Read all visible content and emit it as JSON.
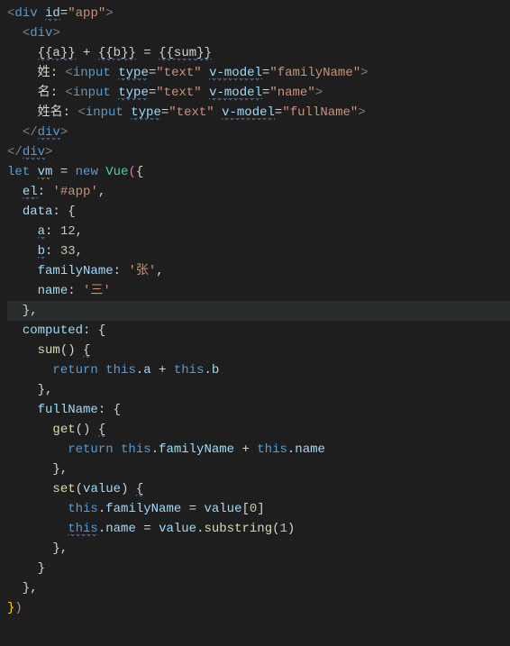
{
  "lines": [
    [
      {
        "t": "<",
        "c": "c-angle"
      },
      {
        "t": "div ",
        "c": "c-tag"
      },
      {
        "t": "id",
        "c": "c-attr",
        "sq": "info"
      },
      {
        "t": "=",
        "c": "c-text"
      },
      {
        "t": "\"app\"",
        "c": "c-str"
      },
      {
        "t": ">",
        "c": "c-angle"
      }
    ],
    [
      {
        "t": "  ",
        "c": ""
      },
      {
        "t": "<",
        "c": "c-angle"
      },
      {
        "t": "div",
        "c": "c-tag"
      },
      {
        "t": ">",
        "c": "c-angle"
      }
    ],
    [
      {
        "t": "    ",
        "c": ""
      },
      {
        "t": "{{",
        "c": "c-text",
        "sq": "info"
      },
      {
        "t": "a",
        "c": "c-text",
        "sq": "info"
      },
      {
        "t": "}}",
        "c": "c-text",
        "sq": "info"
      },
      {
        "t": " + ",
        "c": "c-text"
      },
      {
        "t": "{{",
        "c": "c-text",
        "sq": "info"
      },
      {
        "t": "b",
        "c": "c-text",
        "sq": "info"
      },
      {
        "t": "}}",
        "c": "c-text",
        "sq": "info"
      },
      {
        "t": " = ",
        "c": "c-text"
      },
      {
        "t": "{{",
        "c": "c-text",
        "sq": "info"
      },
      {
        "t": "sum",
        "c": "c-text",
        "sq": "info"
      },
      {
        "t": "}}",
        "c": "c-text",
        "sq": "info"
      }
    ],
    [
      {
        "t": "    姓: ",
        "c": "c-text"
      },
      {
        "t": "<",
        "c": "c-angle"
      },
      {
        "t": "input ",
        "c": "c-tag"
      },
      {
        "t": "type",
        "c": "c-attr",
        "sq": "info"
      },
      {
        "t": "=",
        "c": "c-text"
      },
      {
        "t": "\"text\"",
        "c": "c-str"
      },
      {
        "t": " ",
        "c": ""
      },
      {
        "t": "v-model",
        "c": "c-attr",
        "sq": "info"
      },
      {
        "t": "=",
        "c": "c-text"
      },
      {
        "t": "\"familyName\"",
        "c": "c-str"
      },
      {
        "t": ">",
        "c": "c-angle"
      }
    ],
    [
      {
        "t": "    名: ",
        "c": "c-text"
      },
      {
        "t": "<",
        "c": "c-angle"
      },
      {
        "t": "input ",
        "c": "c-tag"
      },
      {
        "t": "type",
        "c": "c-attr",
        "sq": "info"
      },
      {
        "t": "=",
        "c": "c-text"
      },
      {
        "t": "\"text\"",
        "c": "c-str"
      },
      {
        "t": " ",
        "c": ""
      },
      {
        "t": "v-model",
        "c": "c-attr",
        "sq": "info"
      },
      {
        "t": "=",
        "c": "c-text"
      },
      {
        "t": "\"name\"",
        "c": "c-str"
      },
      {
        "t": ">",
        "c": "c-angle"
      }
    ],
    [
      {
        "t": "    姓名: ",
        "c": "c-text"
      },
      {
        "t": "<",
        "c": "c-angle"
      },
      {
        "t": "input ",
        "c": "c-tag"
      },
      {
        "t": "type",
        "c": "c-attr",
        "sq": "info"
      },
      {
        "t": "=",
        "c": "c-text"
      },
      {
        "t": "\"text\"",
        "c": "c-str"
      },
      {
        "t": " ",
        "c": ""
      },
      {
        "t": "v-model",
        "c": "c-attr",
        "sq": "info"
      },
      {
        "t": "=",
        "c": "c-text"
      },
      {
        "t": "\"fullName\"",
        "c": "c-str"
      },
      {
        "t": ">",
        "c": "c-angle"
      }
    ],
    [
      {
        "t": "  ",
        "c": ""
      },
      {
        "t": "</",
        "c": "c-angle"
      },
      {
        "t": "div",
        "c": "c-tag",
        "sq": "info"
      },
      {
        "t": ">",
        "c": "c-angle"
      }
    ],
    [
      {
        "t": "</",
        "c": "c-angle"
      },
      {
        "t": "div",
        "c": "c-tag",
        "sq": "info"
      },
      {
        "t": ">",
        "c": "c-angle"
      }
    ],
    [
      {
        "t": "let ",
        "c": "c-key"
      },
      {
        "t": "vm",
        "c": "c-attr",
        "sq": "warn"
      },
      {
        "t": " = ",
        "c": "c-text"
      },
      {
        "t": "new ",
        "c": "c-key"
      },
      {
        "t": "Vue",
        "c": "c-type"
      },
      {
        "t": "(",
        "c": "c-brace"
      },
      {
        "t": "{",
        "c": "c-text"
      }
    ],
    [
      {
        "t": "  ",
        "c": ""
      },
      {
        "t": "el",
        "c": "c-attr",
        "sq": "info"
      },
      {
        "t": ": ",
        "c": "c-text"
      },
      {
        "t": "'#app'",
        "c": "c-str"
      },
      {
        "t": ",",
        "c": "c-text"
      }
    ],
    [
      {
        "t": "  ",
        "c": ""
      },
      {
        "t": "data",
        "c": "c-attr"
      },
      {
        "t": ": {",
        "c": "c-text"
      }
    ],
    [
      {
        "t": "    ",
        "c": ""
      },
      {
        "t": "a",
        "c": "c-attr",
        "sq": "info"
      },
      {
        "t": ": ",
        "c": "c-text"
      },
      {
        "t": "12",
        "c": "c-num"
      },
      {
        "t": ",",
        "c": "c-text"
      }
    ],
    [
      {
        "t": "    ",
        "c": ""
      },
      {
        "t": "b",
        "c": "c-attr",
        "sq": "info"
      },
      {
        "t": ": ",
        "c": "c-text"
      },
      {
        "t": "33",
        "c": "c-num"
      },
      {
        "t": ",",
        "c": "c-text"
      }
    ],
    [
      {
        "t": "    ",
        "c": ""
      },
      {
        "t": "familyName",
        "c": "c-attr"
      },
      {
        "t": ": ",
        "c": "c-text"
      },
      {
        "t": "'张'",
        "c": "c-str"
      },
      {
        "t": ",",
        "c": "c-text"
      }
    ],
    [
      {
        "t": "    ",
        "c": ""
      },
      {
        "t": "name",
        "c": "c-attr"
      },
      {
        "t": ": ",
        "c": "c-text"
      },
      {
        "t": "'三'",
        "c": "c-str"
      }
    ],
    [
      {
        "t": "  },",
        "c": "c-text",
        "hl": true
      }
    ],
    [
      {
        "t": "  ",
        "c": ""
      },
      {
        "t": "computed",
        "c": "c-attr"
      },
      {
        "t": ": {",
        "c": "c-text"
      }
    ],
    [
      {
        "t": "    ",
        "c": ""
      },
      {
        "t": "sum",
        "c": "c-fn"
      },
      {
        "t": "() ",
        "c": "c-text"
      },
      {
        "t": "{",
        "c": "c-text",
        "sq": "info"
      }
    ],
    [
      {
        "t": "      ",
        "c": ""
      },
      {
        "t": "return ",
        "c": "c-key"
      },
      {
        "t": "this",
        "c": "c-key"
      },
      {
        "t": ".",
        "c": "c-text"
      },
      {
        "t": "a",
        "c": "c-attr"
      },
      {
        "t": " + ",
        "c": "c-text"
      },
      {
        "t": "this",
        "c": "c-key"
      },
      {
        "t": ".",
        "c": "c-text"
      },
      {
        "t": "b",
        "c": "c-attr"
      }
    ],
    [
      {
        "t": "    },",
        "c": "c-text"
      }
    ],
    [
      {
        "t": "    ",
        "c": ""
      },
      {
        "t": "fullName",
        "c": "c-attr"
      },
      {
        "t": ": {",
        "c": "c-text"
      }
    ],
    [
      {
        "t": "      ",
        "c": ""
      },
      {
        "t": "get",
        "c": "c-fn"
      },
      {
        "t": "() ",
        "c": "c-text"
      },
      {
        "t": "{",
        "c": "c-text",
        "sq": "info"
      }
    ],
    [
      {
        "t": "        ",
        "c": ""
      },
      {
        "t": "return ",
        "c": "c-key"
      },
      {
        "t": "this",
        "c": "c-key"
      },
      {
        "t": ".",
        "c": "c-text"
      },
      {
        "t": "familyName",
        "c": "c-attr"
      },
      {
        "t": " + ",
        "c": "c-text"
      },
      {
        "t": "this",
        "c": "c-key"
      },
      {
        "t": ".",
        "c": "c-text"
      },
      {
        "t": "name",
        "c": "c-attr"
      }
    ],
    [
      {
        "t": "      },",
        "c": "c-text"
      }
    ],
    [
      {
        "t": "      ",
        "c": ""
      },
      {
        "t": "set",
        "c": "c-fn"
      },
      {
        "t": "(",
        "c": "c-text"
      },
      {
        "t": "value",
        "c": "c-attr"
      },
      {
        "t": ") ",
        "c": "c-text"
      },
      {
        "t": "{",
        "c": "c-text",
        "sq": "info"
      }
    ],
    [
      {
        "t": "        ",
        "c": ""
      },
      {
        "t": "this",
        "c": "c-key"
      },
      {
        "t": ".",
        "c": "c-text"
      },
      {
        "t": "familyName",
        "c": "c-attr"
      },
      {
        "t": " = ",
        "c": "c-text"
      },
      {
        "t": "value",
        "c": "c-attr"
      },
      {
        "t": "[",
        "c": "c-text"
      },
      {
        "t": "0",
        "c": "c-num"
      },
      {
        "t": "]",
        "c": "c-text"
      }
    ],
    [
      {
        "t": "        ",
        "c": ""
      },
      {
        "t": "this",
        "c": "c-key",
        "sq": "info"
      },
      {
        "t": ".",
        "c": "c-text"
      },
      {
        "t": "name",
        "c": "c-attr"
      },
      {
        "t": " = ",
        "c": "c-text"
      },
      {
        "t": "value",
        "c": "c-attr"
      },
      {
        "t": ".",
        "c": "c-text"
      },
      {
        "t": "substring",
        "c": "c-fn"
      },
      {
        "t": "(",
        "c": "c-text"
      },
      {
        "t": "1",
        "c": "c-num"
      },
      {
        "t": ")",
        "c": "c-text"
      }
    ],
    [
      {
        "t": "      },",
        "c": "c-text"
      }
    ],
    [
      {
        "t": "    }",
        "c": "c-text"
      }
    ],
    [
      {
        "t": "  },",
        "c": "c-text"
      }
    ],
    [
      {
        "t": "}",
        "c": "c-ybrace"
      },
      {
        "t": ")",
        "c": "c-brace"
      }
    ]
  ]
}
